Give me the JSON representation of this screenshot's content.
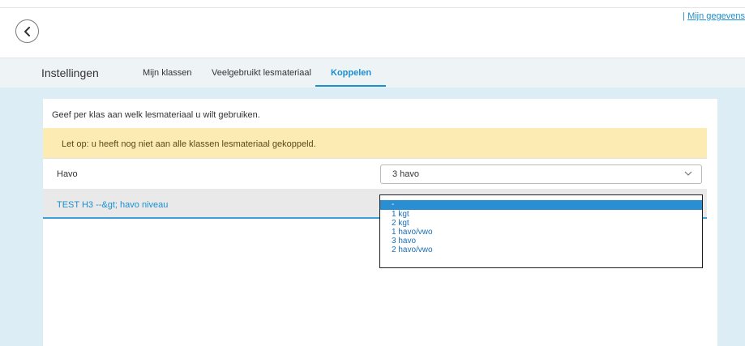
{
  "header": {
    "back_icon": "chevron-left-icon",
    "user_separator": "|",
    "user_link": "Mijn gegevens"
  },
  "tabs": {
    "title": "Instellingen",
    "items": [
      {
        "label": "Mijn klassen",
        "active": false
      },
      {
        "label": "Veelgebruikt lesmateriaal",
        "active": false
      },
      {
        "label": "Koppelen",
        "active": true
      }
    ]
  },
  "content": {
    "intro": "Geef per klas aan welk lesmateriaal u wilt gebruiken.",
    "warning": "Let op: u heeft nog niet aan alle klassen lesmateriaal gekoppeld.",
    "rows": [
      {
        "label": "Havo",
        "selected": "3 havo"
      },
      {
        "label": "TEST H3 --&gt; havo niveau",
        "selected": "-"
      }
    ],
    "dropdown_options": [
      "-",
      "1 kgt",
      "2 kgt",
      "1 havo/vwo",
      "3 havo",
      "2 havo/vwo"
    ]
  },
  "colors": {
    "accent": "#1a8fd1",
    "warning_bg": "#fcebb3",
    "page_bg": "#dcedf6",
    "selected_option_bg": "#2a8fd2"
  }
}
